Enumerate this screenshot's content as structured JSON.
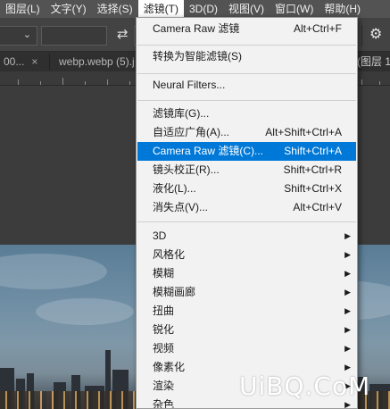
{
  "menubar": {
    "items": [
      {
        "label": "图层(L)",
        "active": false
      },
      {
        "label": "文字(Y)",
        "active": false
      },
      {
        "label": "选择(S)",
        "active": false
      },
      {
        "label": "滤镜(T)",
        "active": true
      },
      {
        "label": "3D(D)",
        "active": false
      },
      {
        "label": "视图(V)",
        "active": false
      },
      {
        "label": "窗口(W)",
        "active": false
      },
      {
        "label": "帮助(H)",
        "active": false
      }
    ]
  },
  "options_bar": {
    "swap_icon": "swap-arrows-icon",
    "settings_icon": "gear-icon"
  },
  "tabs": {
    "left_fragment": "00...",
    "left_close": "×",
    "document": "webp.webp (5).j",
    "right_fragment": "(图层 1"
  },
  "filter_menu": {
    "highlight_color": "#0078d7",
    "items": [
      {
        "label": "Camera Raw 滤镜",
        "shortcut": "Alt+Ctrl+F",
        "submenu": false,
        "highlighted": false
      },
      {
        "separator": true
      },
      {
        "label": "转换为智能滤镜(S)",
        "shortcut": "",
        "submenu": false,
        "highlighted": false
      },
      {
        "separator": true
      },
      {
        "label": "Neural Filters...",
        "shortcut": "",
        "submenu": false,
        "highlighted": false
      },
      {
        "separator": true
      },
      {
        "label": "滤镜库(G)...",
        "shortcut": "",
        "submenu": false,
        "highlighted": false
      },
      {
        "label": "自适应广角(A)...",
        "shortcut": "Alt+Shift+Ctrl+A",
        "submenu": false,
        "highlighted": false
      },
      {
        "label": "Camera Raw 滤镜(C)...",
        "shortcut": "Shift+Ctrl+A",
        "submenu": false,
        "highlighted": true
      },
      {
        "label": "镜头校正(R)...",
        "shortcut": "Shift+Ctrl+R",
        "submenu": false,
        "highlighted": false
      },
      {
        "label": "液化(L)...",
        "shortcut": "Shift+Ctrl+X",
        "submenu": false,
        "highlighted": false
      },
      {
        "label": "消失点(V)...",
        "shortcut": "Alt+Ctrl+V",
        "submenu": false,
        "highlighted": false
      },
      {
        "separator": true
      },
      {
        "label": "3D",
        "shortcut": "",
        "submenu": true,
        "highlighted": false
      },
      {
        "label": "风格化",
        "shortcut": "",
        "submenu": true,
        "highlighted": false
      },
      {
        "label": "模糊",
        "shortcut": "",
        "submenu": true,
        "highlighted": false
      },
      {
        "label": "模糊画廊",
        "shortcut": "",
        "submenu": true,
        "highlighted": false
      },
      {
        "label": "扭曲",
        "shortcut": "",
        "submenu": true,
        "highlighted": false
      },
      {
        "label": "锐化",
        "shortcut": "",
        "submenu": true,
        "highlighted": false
      },
      {
        "label": "视频",
        "shortcut": "",
        "submenu": true,
        "highlighted": false
      },
      {
        "label": "像素化",
        "shortcut": "",
        "submenu": true,
        "highlighted": false
      },
      {
        "label": "渲染",
        "shortcut": "",
        "submenu": true,
        "highlighted": false
      },
      {
        "label": "杂色",
        "shortcut": "",
        "submenu": true,
        "highlighted": false
      }
    ]
  },
  "watermark": {
    "text": "UiBQ.CoM"
  }
}
